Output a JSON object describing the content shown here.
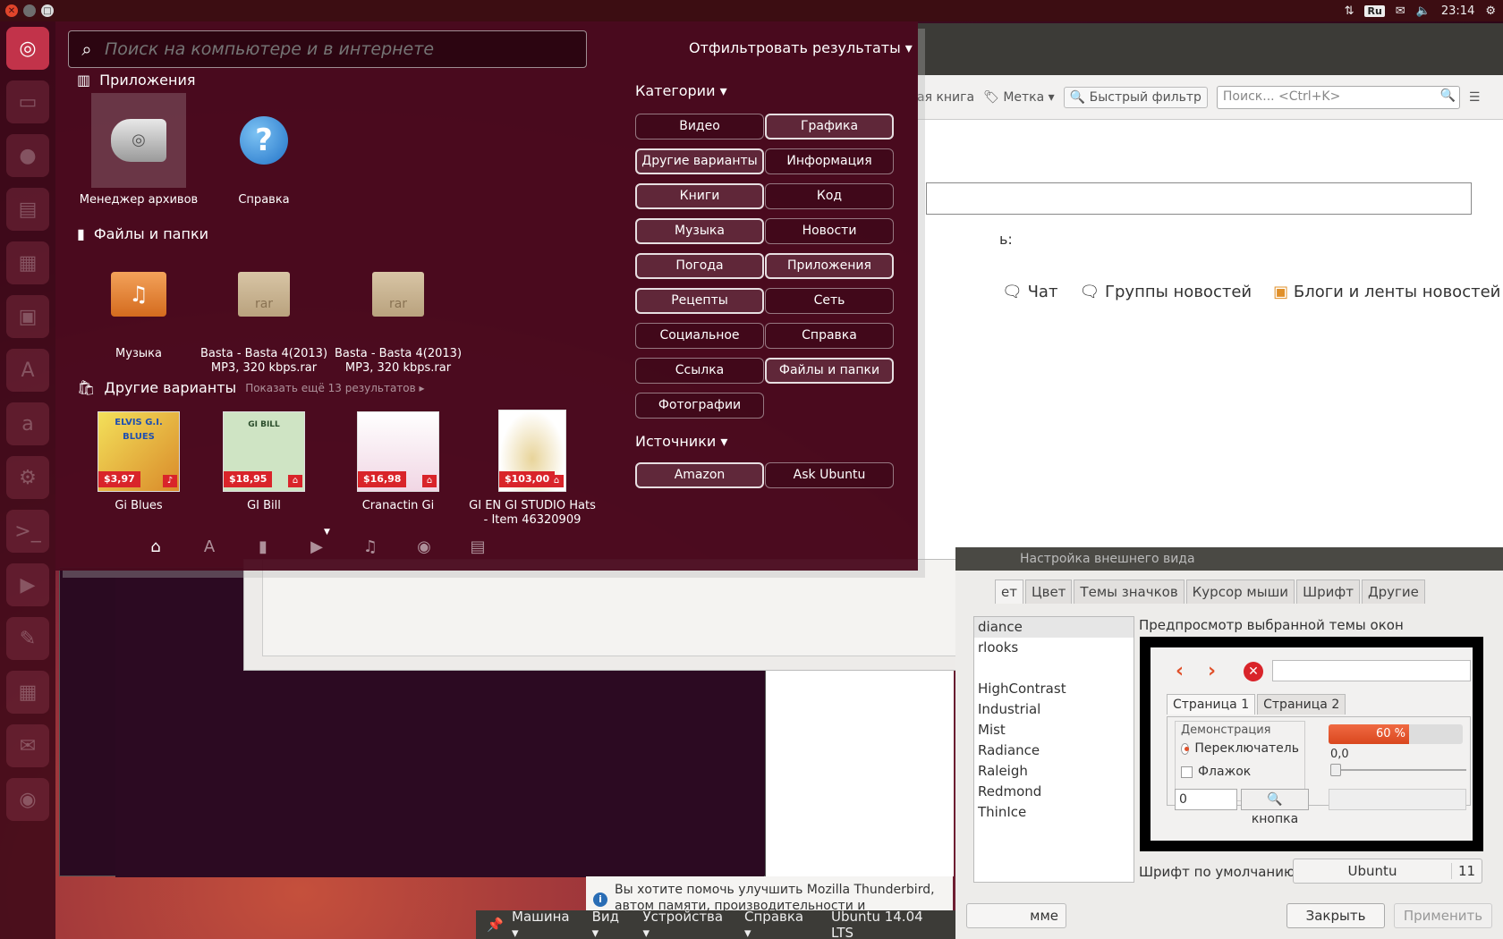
{
  "top_panel": {
    "lang": "Ru",
    "time": "23:14",
    "icons": [
      "network-icon",
      "mail-icon",
      "volume-icon",
      "gear-icon"
    ]
  },
  "dash": {
    "search_placeholder": "Поиск на компьютере и в интернете",
    "filter_label": "Отфильтровать результаты",
    "sections": {
      "apps": "Приложения",
      "files": "Файлы и папки",
      "more": "Другие варианты",
      "more_hint": "Показать ещё 13 результатов"
    },
    "apps": [
      {
        "label": "Менеджер архивов"
      },
      {
        "label": "Справка"
      }
    ],
    "files": [
      {
        "label": "Музыка"
      },
      {
        "label": "Basta - Basta 4(2013) MP3, 320 kbps.rar",
        "icon_text": "rar"
      },
      {
        "label": "Basta - Basta 4(2013) MP3, 320 kbps.rar",
        "icon_text": "rar"
      }
    ],
    "products": [
      {
        "label": "Gi Blues",
        "price": "$3,97",
        "art": "ELVIS G.I. BLUES"
      },
      {
        "label": "GI Bill",
        "price": "$18,95",
        "art": "GI BILL"
      },
      {
        "label": "Cranactin Gi",
        "price": "$16,98"
      },
      {
        "label": "GI EN GI STUDIO Hats - Item 46320909",
        "price": "$103,00"
      }
    ],
    "categories_label": "Категории",
    "categories": [
      {
        "label": "Видео",
        "active": false
      },
      {
        "label": "Графика",
        "active": true
      },
      {
        "label": "Другие варианты",
        "active": true
      },
      {
        "label": "Информация",
        "active": false
      },
      {
        "label": "Книги",
        "active": true
      },
      {
        "label": "Код",
        "active": false
      },
      {
        "label": "Музыка",
        "active": true
      },
      {
        "label": "Новости",
        "active": false
      },
      {
        "label": "Погода",
        "active": true
      },
      {
        "label": "Приложения",
        "active": true
      },
      {
        "label": "Рецепты",
        "active": true
      },
      {
        "label": "Сеть",
        "active": false
      },
      {
        "label": "Социальное",
        "active": false
      },
      {
        "label": "Справка",
        "active": false
      },
      {
        "label": "Ссылка",
        "active": false
      },
      {
        "label": "Файлы и папки",
        "active": true
      },
      {
        "label": "Фотографии",
        "active": false
      }
    ],
    "sources_label": "Источники",
    "sources": [
      {
        "label": "Amazon",
        "active": true
      },
      {
        "label": "Ask Ubuntu",
        "active": false
      }
    ]
  },
  "thunderbird": {
    "book_partial": "ая книга",
    "tag_label": "Метка",
    "quick_filter": "Быстрый фильтр",
    "search_placeholder": "Поиск... <Ctrl+K>",
    "partial_colon": "ь:",
    "links": [
      "Чат",
      "Группы новостей",
      "Блоги и ленты новостей"
    ],
    "notification": "Вы хотите помочь улучшить Mozilla Thunderbird, автом памяти, производительности и отзывчивости в Mozilla"
  },
  "vm_menu": {
    "items": [
      "Машина",
      "Вид",
      "Устройства",
      "Справка"
    ],
    "title": "Ubuntu 14.04 LTS"
  },
  "appearance": {
    "title": "Настройка внешнего вида",
    "tabs": [
      "ет",
      "Цвет",
      "Темы значков",
      "Курсор мыши",
      "Шрифт",
      "Другие"
    ],
    "themes": [
      "diance",
      "rlooks",
      "",
      "HighContrast",
      "Industrial",
      "Mist",
      "Radiance",
      "Raleigh",
      "Redmond",
      "ThinIce"
    ],
    "preview_label": "Предпросмотр выбранной темы окон",
    "preview": {
      "tab1": "Страница 1",
      "tab2": "Страница 2",
      "demo_label": "Демонстрация",
      "radio_label": "Переключатель",
      "check_label": "Флажок",
      "progress_text": "60 %",
      "progress": 0.6,
      "scale_value": "0,0",
      "spin_value": "0",
      "button_label": "кнопка"
    },
    "font_label": "Шрифт по умолчанию:",
    "font_name": "Ubuntu",
    "font_size": "11",
    "left_button": "мме",
    "close_button": "Закрыть",
    "apply_button": "Применить"
  }
}
